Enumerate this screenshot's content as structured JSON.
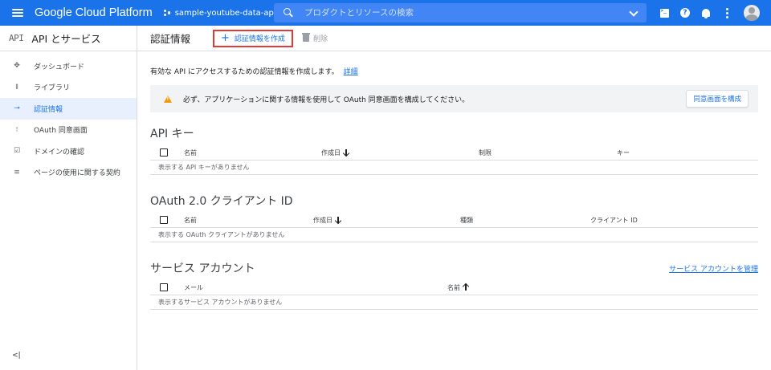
{
  "topbar": {
    "brand": "Google Cloud Platform",
    "project": "sample-youtube-data-api",
    "search_placeholder": "プロダクトとリソースの検索",
    "icons": [
      "menu-icon",
      "project-icon",
      "search-icon",
      "cloud-shell-icon",
      "help-icon",
      "notifications-icon",
      "more-vert-icon",
      "account-avatar"
    ]
  },
  "sidebar": {
    "logo": "API",
    "title": "API とサービス",
    "items": [
      {
        "label": "ダッシュボード",
        "icon": "dashboard-icon",
        "glyph": "✥"
      },
      {
        "label": "ライブラリ",
        "icon": "library-icon",
        "glyph": "𝍪"
      },
      {
        "label": "認証情報",
        "icon": "key-icon",
        "glyph": "⊸"
      },
      {
        "label": "OAuth 同意画面",
        "icon": "consent-icon",
        "glyph": "⁝"
      },
      {
        "label": "ドメインの確認",
        "icon": "domain-icon",
        "glyph": "☑"
      },
      {
        "label": "ページの使用に関する契約",
        "icon": "agreements-icon",
        "glyph": "≡"
      }
    ],
    "active_index": 2,
    "collapse": "<|"
  },
  "header": {
    "title": "認証情報",
    "create_label": "認証情報を作成",
    "delete_label": "削除"
  },
  "description": {
    "text": "有効な API にアクセスするための認証情報を作成します。",
    "link": "詳細"
  },
  "warning": {
    "text": "必ず、アプリケーションに関する情報を使用して OAuth 同意画面を構成してください。",
    "button": "同意画面を構成",
    "color": "#f29900"
  },
  "api_keys": {
    "title": "API キー",
    "columns": [
      "名前",
      "作成日",
      "制限",
      "キー"
    ],
    "empty": "表示する API キーがありません"
  },
  "oauth": {
    "title": "OAuth 2.0 クライアント ID",
    "columns": [
      "名前",
      "作成日",
      "種類",
      "クライアント ID"
    ],
    "empty": "表示する OAuth クライアントがありません"
  },
  "service_accounts": {
    "title": "サービス アカウント",
    "manage_link": "サービス アカウントを管理",
    "columns": [
      "メール",
      "名前"
    ],
    "empty": "表示するサービス アカウントがありません"
  },
  "colors": {
    "primary": "#1a73e8",
    "highlight_border": "#e53935"
  }
}
